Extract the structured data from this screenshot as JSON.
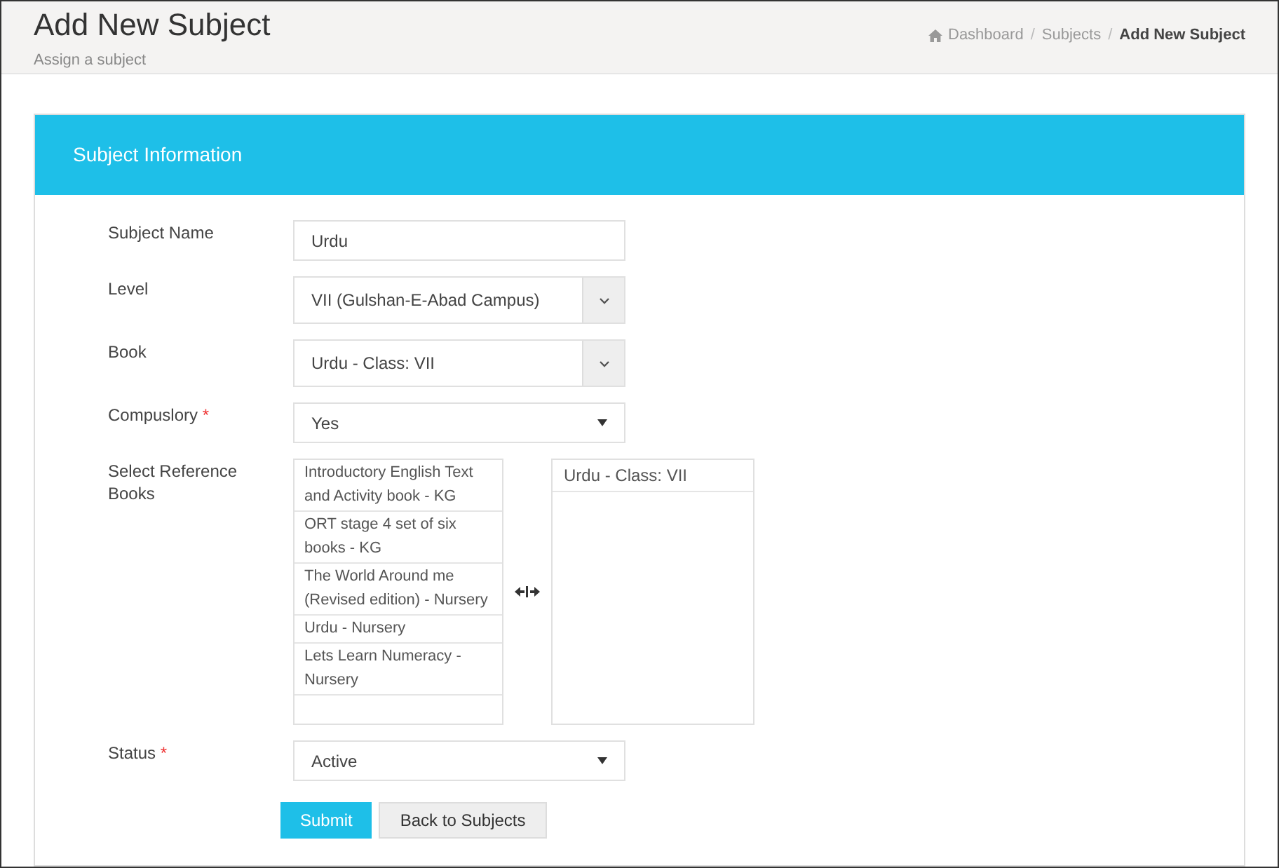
{
  "header": {
    "title": "Add New Subject",
    "subtitle": "Assign a subject"
  },
  "breadcrumb": [
    {
      "label": "Dashboard",
      "kind": "home",
      "current": false
    },
    {
      "label": "Subjects",
      "kind": "link",
      "current": false,
      "separator": "/"
    },
    {
      "label": "Add New Subject",
      "kind": "link",
      "current": true,
      "separator": "/"
    }
  ],
  "panel": {
    "title": "Subject Information"
  },
  "fields": [
    {
      "label": "Subject Name",
      "kind": "text",
      "value": "Urdu"
    },
    {
      "label": "Level",
      "kind": "combo",
      "value": "VII (Gulshan-E-Abad Campus)"
    },
    {
      "label": "Book",
      "kind": "combo",
      "value": "Urdu - Class: VII"
    },
    {
      "label": "Compuslory",
      "required_mark": "*",
      "kind": "select",
      "value": "Yes"
    },
    {
      "label": "Select Reference Books",
      "kind": "dual",
      "available": [
        "Introductory English Text and Activity book - KG",
        "ORT stage 4 set of six books - KG",
        "The World Around me (Revised edition) - Nursery",
        "Urdu - Nursery",
        "Lets Learn Numeracy - Nursery"
      ],
      "chosen": [
        "Urdu - Class: VII"
      ]
    },
    {
      "label": "Status",
      "required_mark": "*",
      "kind": "select",
      "value": "Active"
    }
  ],
  "buttons": [
    {
      "label": "Submit",
      "kind": "primary"
    },
    {
      "label": "Back to Subjects",
      "kind": "secondary"
    }
  ]
}
